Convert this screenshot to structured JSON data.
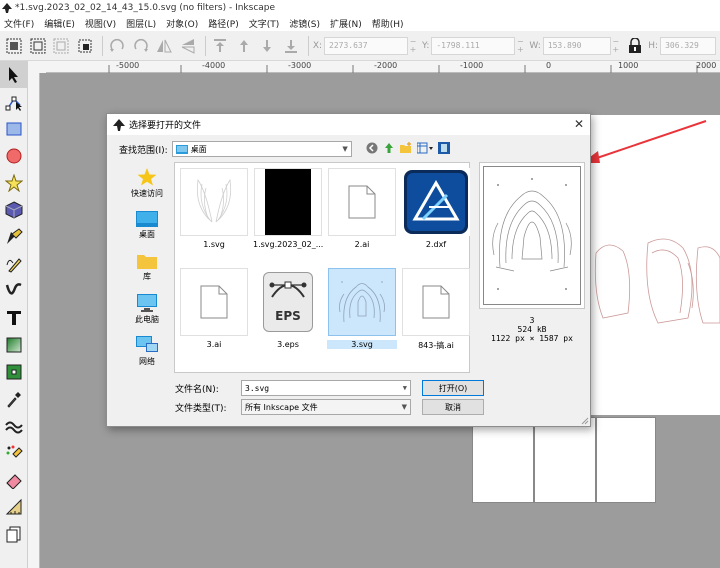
{
  "window": {
    "title": "*1.svg.2023_02_02_14_43_15.0.svg (no filters) - Inkscape"
  },
  "menu": [
    {
      "label": "文件(F)"
    },
    {
      "label": "编辑(E)"
    },
    {
      "label": "视图(V)"
    },
    {
      "label": "图层(L)"
    },
    {
      "label": "对象(O)"
    },
    {
      "label": "路径(P)"
    },
    {
      "label": "文字(T)"
    },
    {
      "label": "滤镜(S)"
    },
    {
      "label": "扩展(N)"
    },
    {
      "label": "帮助(H)"
    }
  ],
  "coords": {
    "x": {
      "label": "X:",
      "value": "2273.637"
    },
    "y": {
      "label": "Y:",
      "value": "-1798.111"
    },
    "w": {
      "label": "W:",
      "value": "153.890"
    },
    "h": {
      "label": "H:",
      "value": "306.329"
    }
  },
  "ruler": {
    "ticks": [
      {
        "label": "-5000"
      },
      {
        "label": "-4000"
      },
      {
        "label": "-3000"
      },
      {
        "label": "-2000"
      },
      {
        "label": "-1000"
      },
      {
        "label": "0"
      },
      {
        "label": "1000"
      },
      {
        "label": "2000"
      }
    ]
  },
  "dialog": {
    "title": "选择要打开的文件",
    "look_in_label": "查找范围(I):",
    "look_in_value": "桌面",
    "places": [
      {
        "label": "快速访问",
        "icon": "star-icon"
      },
      {
        "label": "桌面",
        "icon": "desktop-icon"
      },
      {
        "label": "库",
        "icon": "folder-icon"
      },
      {
        "label": "此电脑",
        "icon": "computer-icon"
      },
      {
        "label": "网络",
        "icon": "network-icon"
      }
    ],
    "files": [
      {
        "name": "1.svg",
        "kind": "wings"
      },
      {
        "name": "1.svg.2023_02_...",
        "kind": "black"
      },
      {
        "name": "2.ai",
        "kind": "doc"
      },
      {
        "name": "2.dxf",
        "kind": "affinity"
      },
      {
        "name": "3.ai",
        "kind": "doc"
      },
      {
        "name": "3.eps",
        "kind": "eps"
      },
      {
        "name": "3.svg",
        "kind": "shoe",
        "selected": true
      },
      {
        "name": "843-搞.ai",
        "kind": "doc"
      }
    ],
    "eps_badge": "EPS",
    "preview": {
      "name": "3",
      "size": "524 kB",
      "dims": "1122 px × 1587 px"
    },
    "filename_label": "文件名(N):",
    "filename_value": "3.svg",
    "filetype_label": "文件类型(T):",
    "filetype_value": "所有 Inkscape 文件",
    "open_button": "打开(O)",
    "cancel_button": "取消"
  },
  "colors": {
    "arrow": "#e8343a",
    "selection": "#cce6fb",
    "affinity": "#0e4d9e"
  }
}
